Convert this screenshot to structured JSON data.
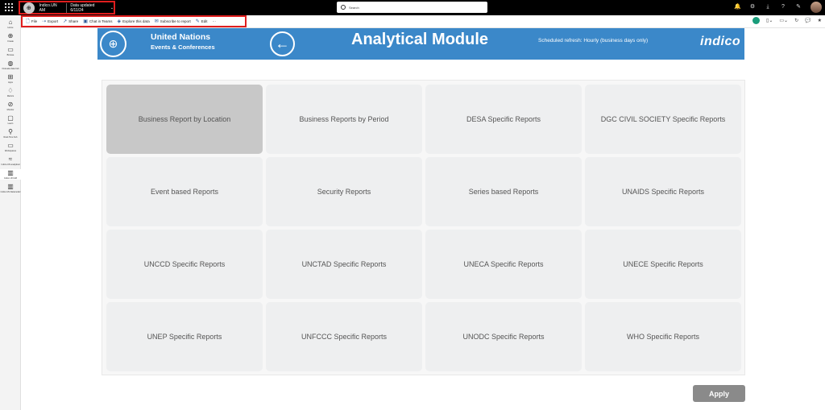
{
  "topbar": {
    "workspace_name": "Indico.UN AM",
    "data_updated": "Data updated 6/11/24",
    "search_placeholder": "Search"
  },
  "toolbar": {
    "items": [
      {
        "label": "File",
        "icon": "file-icon"
      },
      {
        "label": "Export",
        "icon": "export-icon"
      },
      {
        "label": "Share",
        "icon": "share-icon"
      },
      {
        "label": "Chat in Teams",
        "icon": "teams-icon"
      },
      {
        "label": "Explore this data",
        "icon": "explore-icon"
      },
      {
        "label": "Subscribe to report",
        "icon": "subscribe-icon"
      },
      {
        "label": "Edit",
        "icon": "edit-icon"
      }
    ],
    "more": "···"
  },
  "leftnav": {
    "items": [
      {
        "label": "Home",
        "icon": "home-icon"
      },
      {
        "label": "Create",
        "icon": "create-icon"
      },
      {
        "label": "Browse",
        "icon": "browse-icon"
      },
      {
        "label": "OneLake data hub",
        "icon": "datahub-icon"
      },
      {
        "label": "Apps",
        "icon": "apps-icon"
      },
      {
        "label": "Metrics",
        "icon": "metrics-icon"
      },
      {
        "label": "Monitor",
        "icon": "monitor-icon"
      },
      {
        "label": "Learn",
        "icon": "learn-icon"
      },
      {
        "label": "Real-Time hub",
        "icon": "realtime-icon"
      },
      {
        "label": "Workspaces",
        "icon": "workspaces-icon"
      },
      {
        "label": "Indico.UN analytical",
        "icon": "workspace-icon"
      },
      {
        "label": "Indico.UN AM",
        "icon": "report-icon"
      },
      {
        "label": "Indico.UN Datamodel",
        "icon": "report-icon"
      }
    ]
  },
  "banner": {
    "org_line1": "United Nations",
    "org_line2": "Events & Conferences",
    "title": "Analytical Module",
    "refresh": "Scheduled refresh: Hourly (business days only)",
    "brand": "indico"
  },
  "tiles": [
    "Business Report by Location",
    "Business Reports by Period",
    "DESA Specific Reports",
    "DGC CIVIL SOCIETY Specific Reports",
    "Event based Reports",
    "Security Reports",
    "Series based Reports",
    "UNAIDS Specific Reports",
    "UNCCD Specific Reports",
    "UNCTAD Specific Reports",
    "UNECA Specific Reports",
    "UNECE Specific Reports",
    "UNEP Specific Reports",
    "UNFCCC Specific Reports",
    "UNODC Specific Reports",
    "WHO Specific Reports"
  ],
  "apply_label": "Apply"
}
